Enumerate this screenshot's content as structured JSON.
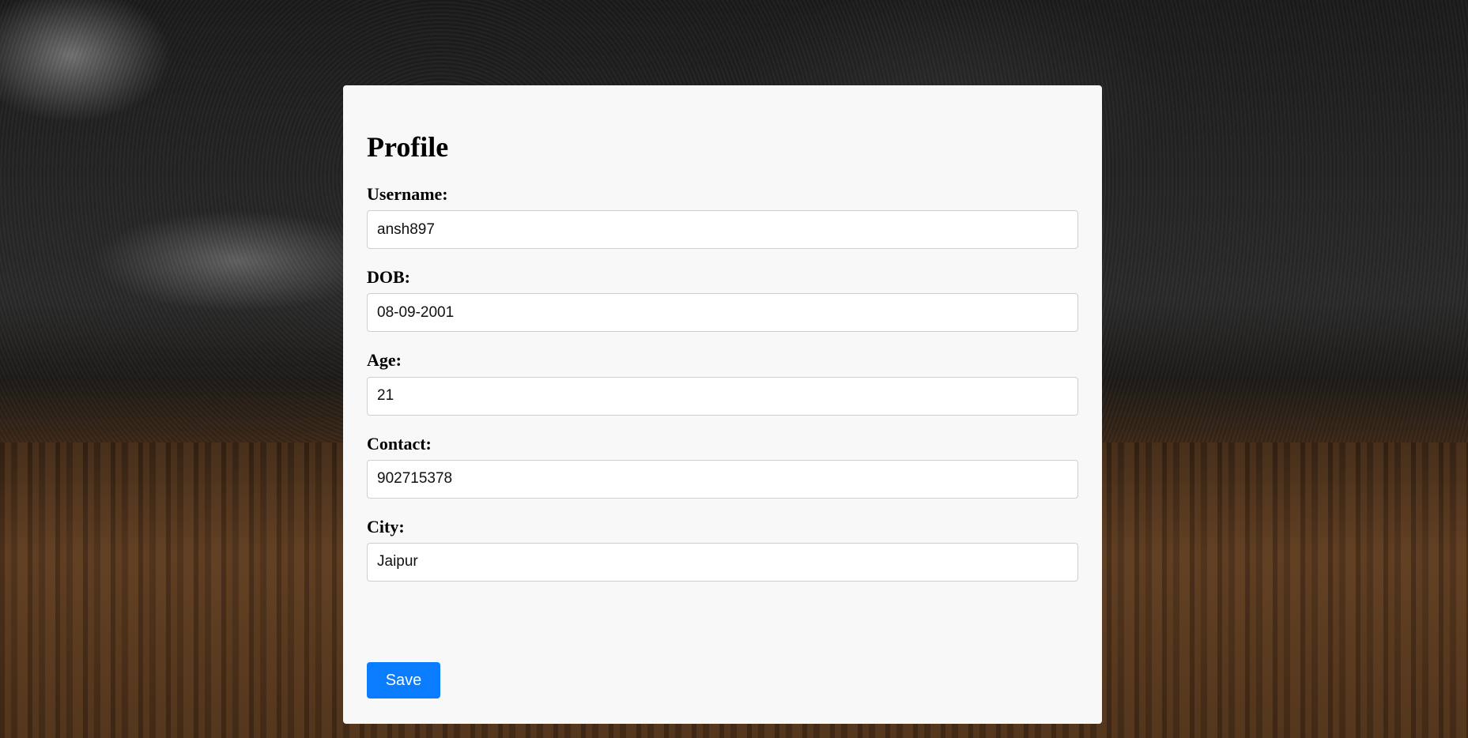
{
  "profile": {
    "title": "Profile",
    "fields": [
      {
        "label": "Username:",
        "value": "ansh897"
      },
      {
        "label": "DOB:",
        "value": "08-09-2001"
      },
      {
        "label": "Age:",
        "value": "21"
      },
      {
        "label": "Contact:",
        "value": "902715378"
      },
      {
        "label": "City:",
        "value": "Jaipur"
      }
    ],
    "save_label": "Save"
  },
  "colors": {
    "card_background": "#f8f8f8",
    "primary_button": "#0a7cff"
  }
}
